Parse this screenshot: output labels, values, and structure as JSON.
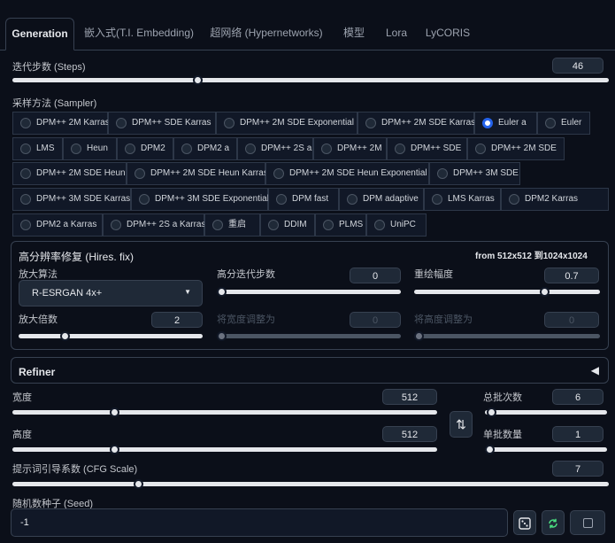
{
  "tabs": [
    "Generation",
    "嵌入式(T.I. Embedding)",
    "超网络 (Hypernetworks)",
    "模型",
    "Lora",
    "LyCORIS"
  ],
  "steps": {
    "label": "迭代步数 (Steps)",
    "value": "46",
    "fraction": 0.31
  },
  "sampler": {
    "label": "采样方法 (Sampler)",
    "selected": "Euler a",
    "rows": [
      [
        "DPM++ 2M Karras",
        "DPM++ SDE Karras",
        "DPM++ 2M SDE Exponential",
        "DPM++ 2M SDE Karras",
        "Euler a",
        "Euler"
      ],
      [
        "LMS",
        "Heun",
        "DPM2",
        "DPM2 a",
        "DPM++ 2S a",
        "DPM++ 2M",
        "DPM++ SDE",
        "DPM++ 2M SDE"
      ],
      [
        "DPM++ 2M SDE Heun",
        "DPM++ 2M SDE Heun Karras",
        "DPM++ 2M SDE Heun Exponential",
        "DPM++ 3M SDE"
      ],
      [
        "DPM++ 3M SDE Karras",
        "DPM++ 3M SDE Exponential",
        "DPM fast",
        "DPM adaptive",
        "LMS Karras",
        "DPM2 Karras"
      ],
      [
        "DPM2 a Karras",
        "DPM++ 2S a Karras",
        "重启",
        "DDIM",
        "PLMS",
        "UniPC"
      ]
    ]
  },
  "hires": {
    "title": "高分辨率修复 (Hires. fix)",
    "info": "from 512x512 到1024x1024",
    "upscaler_label": "放大算法",
    "upscaler_value": "R-ESRGAN 4x+",
    "hires_steps_label": "高分迭代步数",
    "hires_steps_value": "0",
    "hires_steps_fraction": 0.0,
    "denoise_label": "重绘幅度",
    "denoise_value": "0.7",
    "denoise_fraction": 0.7,
    "scale_label": "放大倍数",
    "scale_value": "2",
    "scale_fraction": 0.25,
    "resize_w_label": "将宽度调整为",
    "resize_w_value": "0",
    "resize_w_fraction": 0.0,
    "resize_h_label": "将高度调整为",
    "resize_h_value": "0",
    "resize_h_fraction": 0.0
  },
  "refiner": {
    "label": "Refiner",
    "arrow": "◀"
  },
  "width": {
    "label": "宽度",
    "value": "512",
    "fraction": 0.24
  },
  "height": {
    "label": "高度",
    "value": "512",
    "fraction": 0.24
  },
  "swap_icon": "⇅",
  "batch_count": {
    "label": "总批次数",
    "value": "6",
    "fraction": 0.05
  },
  "batch_size": {
    "label": "单批数量",
    "value": "1",
    "fraction": 0.0
  },
  "cfg": {
    "label": "提示词引导系数 (CFG Scale)",
    "value": "7",
    "fraction": 0.21
  },
  "seed": {
    "label": "随机数种子 (Seed)",
    "value": "-1"
  },
  "colors": {
    "accent": "#2563eb",
    "bg": "#0b0f19",
    "panel_border": "#374151"
  }
}
